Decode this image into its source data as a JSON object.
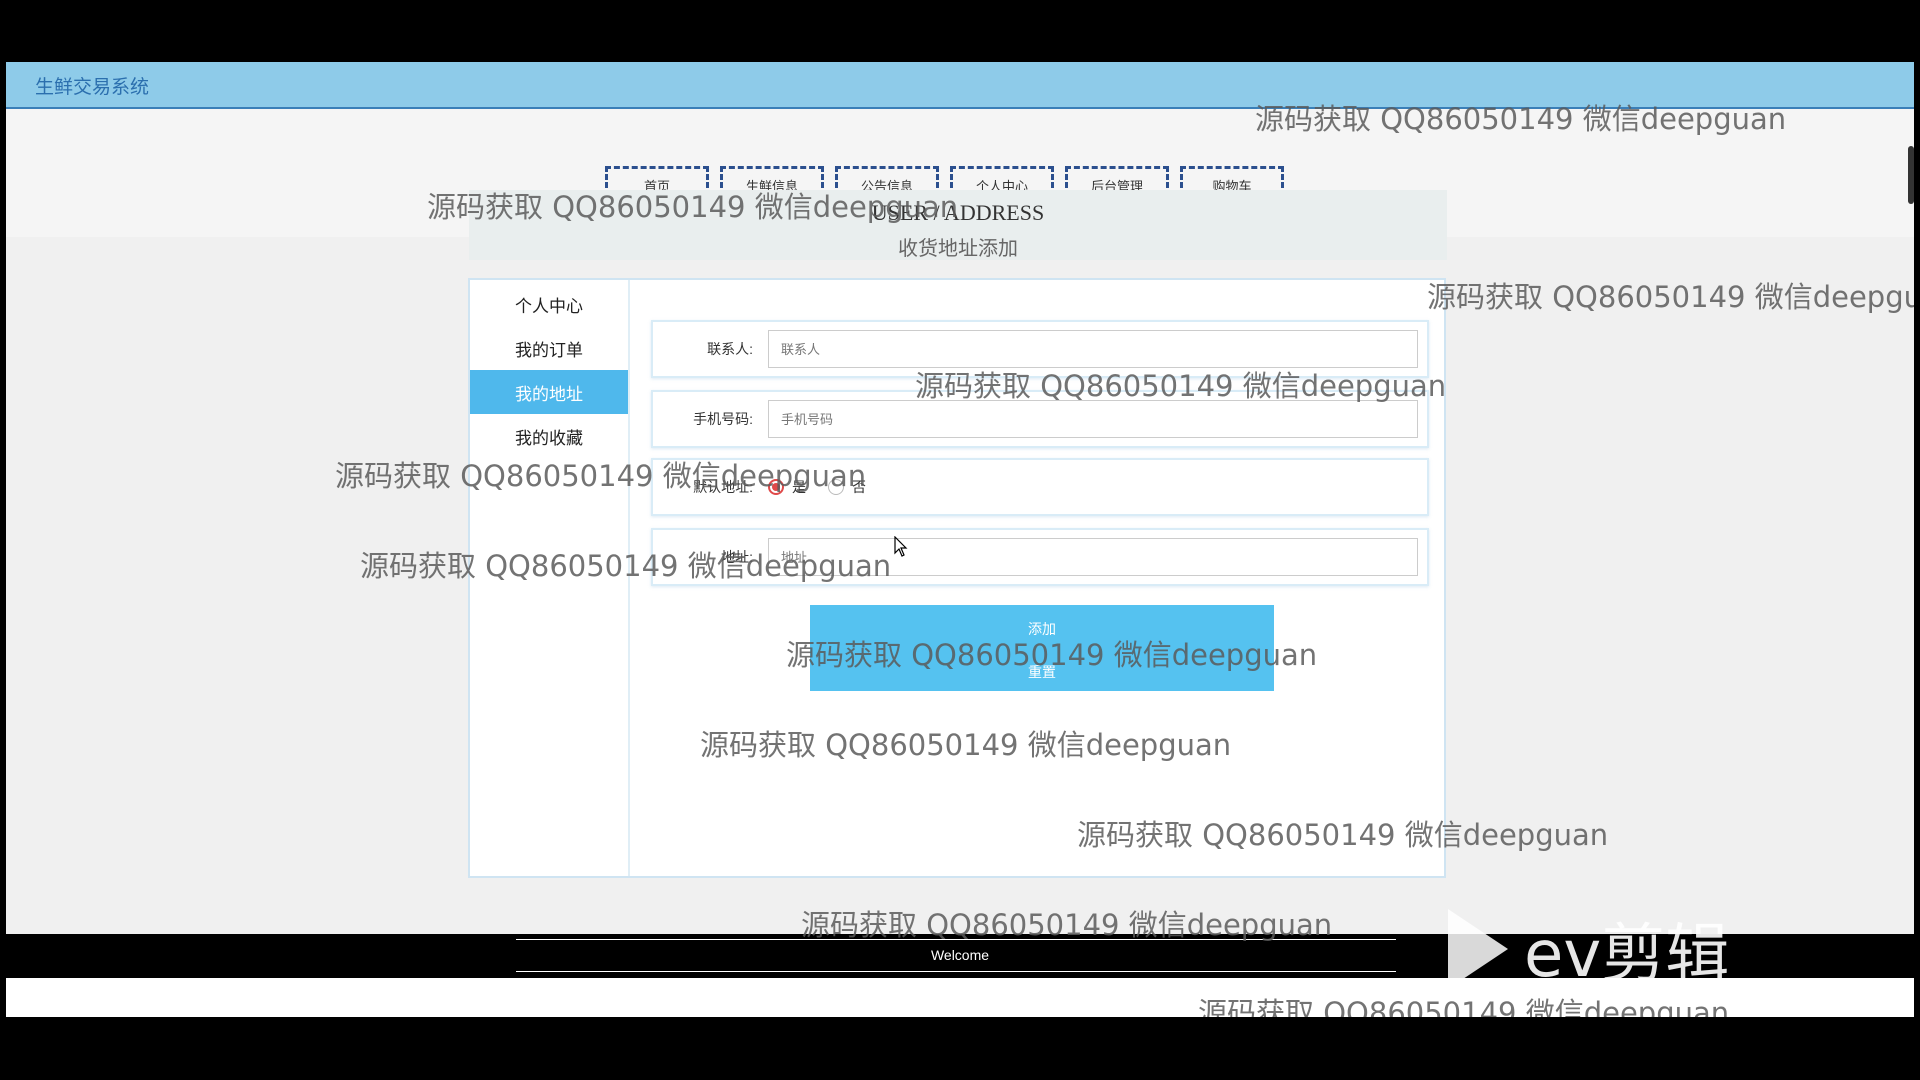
{
  "app": {
    "title": "生鲜交易系统"
  },
  "nav": {
    "items": [
      "首页",
      "生鲜信息",
      "公告信息",
      "个人中心",
      "后台管理",
      "购物车"
    ]
  },
  "heading": {
    "english": "USER / ADDRESS",
    "chinese": "收货地址添加"
  },
  "sidebar": {
    "items": [
      {
        "label": "个人中心",
        "active": false
      },
      {
        "label": "我的订单",
        "active": false
      },
      {
        "label": "我的地址",
        "active": true
      },
      {
        "label": "我的收藏",
        "active": false
      }
    ]
  },
  "form": {
    "contact_label": "联系人:",
    "contact_placeholder": "联系人",
    "phone_label": "手机号码:",
    "phone_placeholder": "手机号码",
    "default_label": "默认地址:",
    "default_options": [
      "是",
      "否"
    ],
    "default_selected": "是",
    "address_label": "地址:",
    "address_placeholder": "地址",
    "add_button": "添加",
    "reset_button": "重置"
  },
  "footer": {
    "welcome": "Welcome"
  },
  "watermark": {
    "text": "源码获取 QQ86050149 微信deepguan"
  },
  "overlay_logo": {
    "text": "ev剪辑"
  },
  "colors": {
    "topbar": "#8ecbe9",
    "accent": "#55c2f0",
    "sidebar_active": "#4fb8ec",
    "nav_border": "#2b4f8e"
  }
}
